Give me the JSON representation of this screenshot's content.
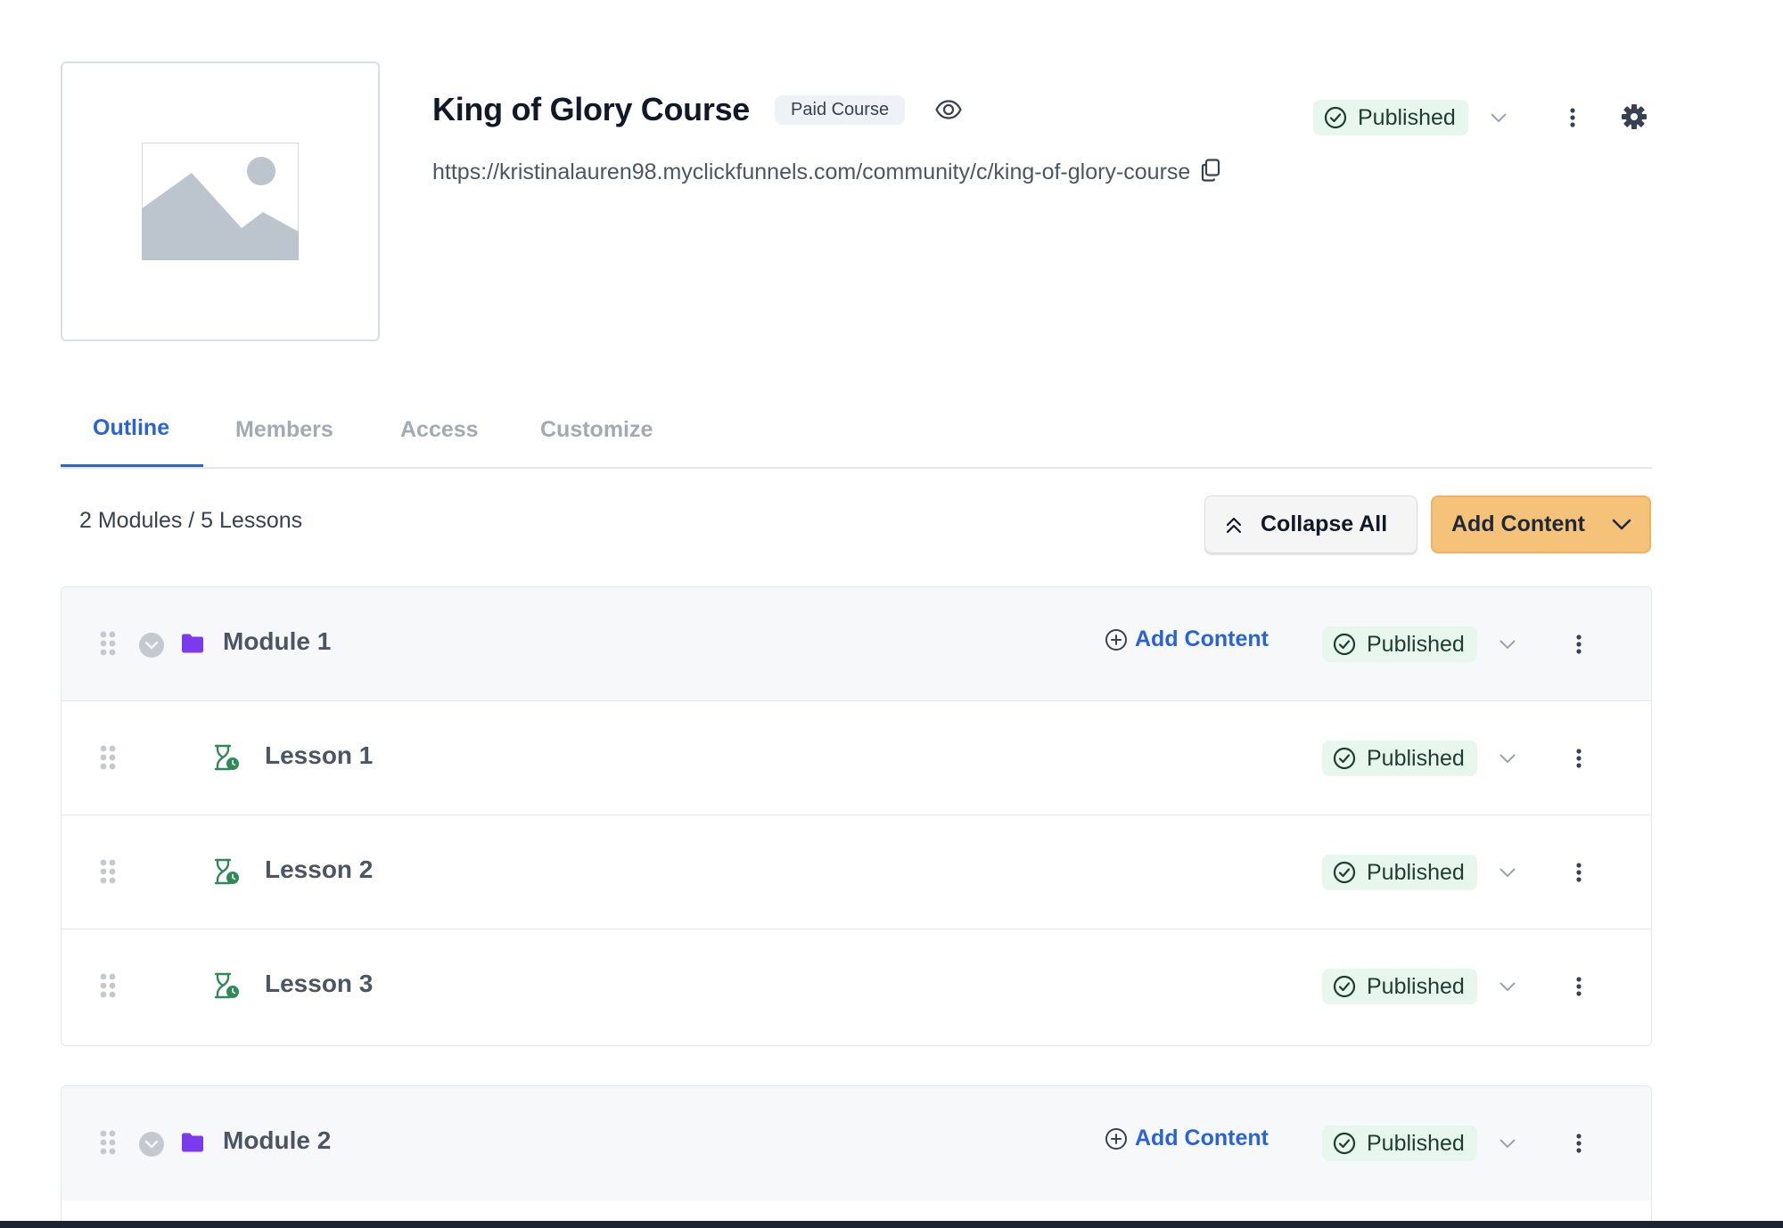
{
  "course": {
    "title": "King of Glory Course",
    "badge": "Paid Course",
    "url": "https://kristinalauren98.myclickfunnels.com/community/c/king-of-glory-course",
    "status": "Published"
  },
  "tabs": [
    {
      "label": "Outline",
      "active": true
    },
    {
      "label": "Members",
      "active": false
    },
    {
      "label": "Access",
      "active": false
    },
    {
      "label": "Customize",
      "active": false
    }
  ],
  "toolbar": {
    "summary": "2 Modules / 5 Lessons",
    "collapse_label": "Collapse All",
    "add_content_label": "Add Content"
  },
  "modules": [
    {
      "title": "Module 1",
      "add_label": "Add Content",
      "status": "Published",
      "lessons": [
        {
          "title": "Lesson 1",
          "status": "Published"
        },
        {
          "title": "Lesson 2",
          "status": "Published"
        },
        {
          "title": "Lesson 3",
          "status": "Published"
        }
      ]
    },
    {
      "title": "Module 2",
      "add_label": "Add Content",
      "status": "Published",
      "lessons": []
    }
  ],
  "icons": {
    "thumbnail": "image-placeholder-icon",
    "preview": "eye-icon",
    "copy": "copy-icon",
    "status": "check-circle-icon",
    "dropdown": "chevron-down-icon",
    "more": "more-vertical-icon",
    "settings": "gear-icon",
    "collapse": "chevrons-up-icon",
    "drag": "drag-handle-icon",
    "module": "folder-icon",
    "lesson": "hourglass-clock-icon",
    "add": "plus-circle-icon"
  },
  "colors": {
    "accent": "#2a63d6",
    "primary_button": "#f5c27a",
    "status_bg": "#e7f7ee",
    "status_icon": "#1f3d2f",
    "folder": "#7c3aed",
    "lesson_icon": "#2f8a5a"
  }
}
